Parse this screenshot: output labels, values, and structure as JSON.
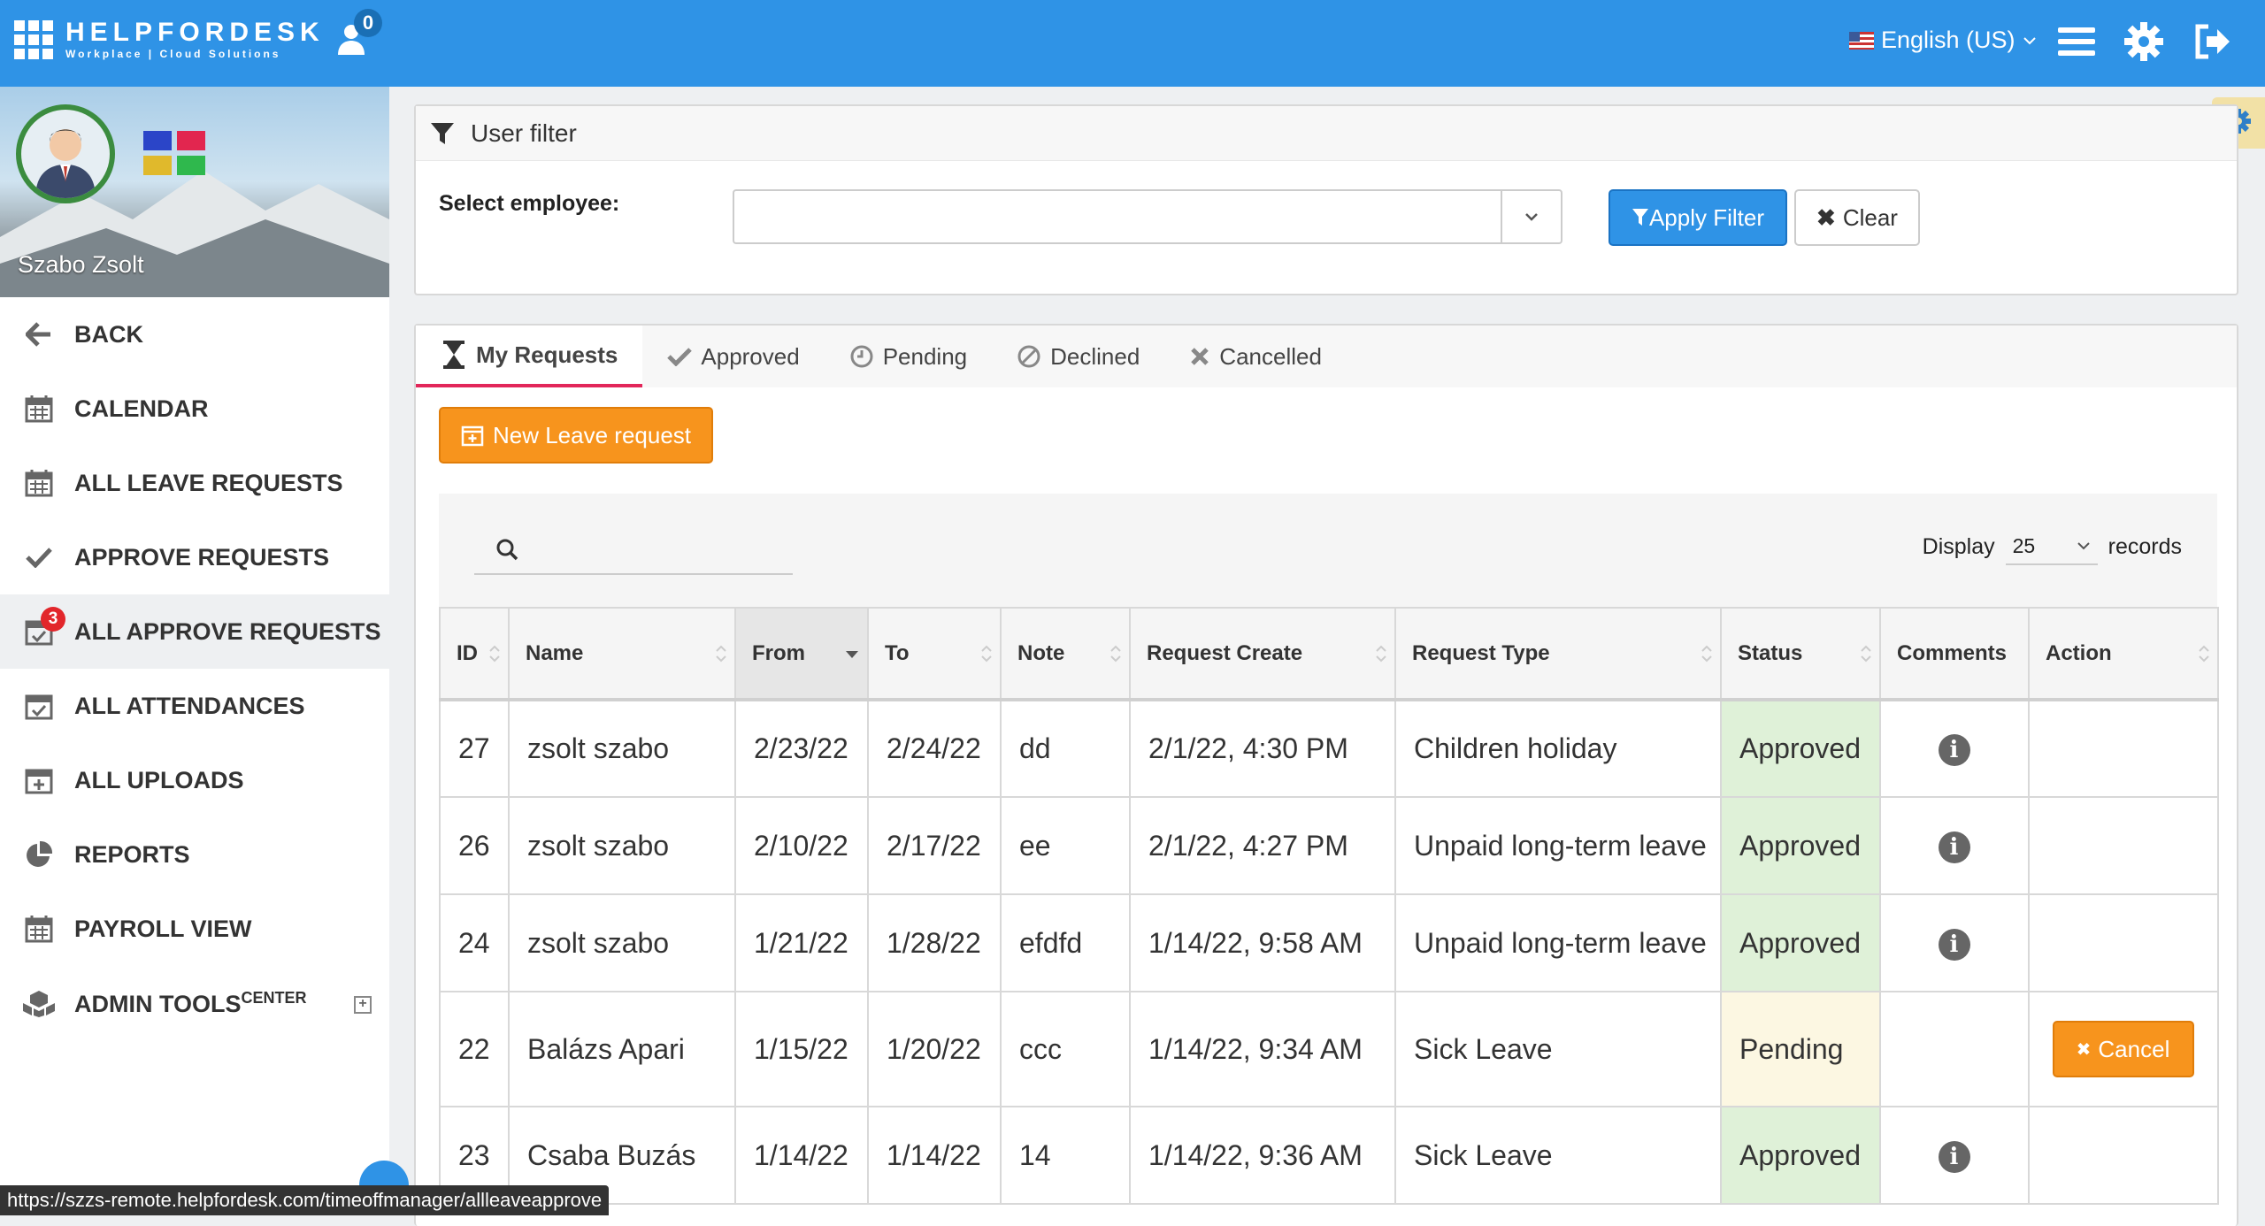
{
  "header": {
    "brand_name": "HELPFORDESK",
    "brand_sub": "Workplace | Cloud Solutions",
    "notifications": "0",
    "language": "English (US)"
  },
  "sidebar": {
    "user_name": "Szabo Zsolt",
    "items": [
      {
        "label": "BACK",
        "icon": "arrow-left-icon"
      },
      {
        "label": "CALENDAR",
        "icon": "calendar-icon"
      },
      {
        "label": "ALL LEAVE REQUESTS",
        "icon": "calendar-icon"
      },
      {
        "label": "APPROVE REQUESTS",
        "icon": "check-icon"
      },
      {
        "label": "ALL APPROVE REQUESTS",
        "icon": "calendar-check-icon",
        "badge": "3"
      },
      {
        "label": "ALL ATTENDANCES",
        "icon": "calendar-check-icon"
      },
      {
        "label": "ALL UPLOADS",
        "icon": "calendar-plus-icon"
      },
      {
        "label": "REPORTS",
        "icon": "pie-chart-icon"
      },
      {
        "label": "PAYROLL VIEW",
        "icon": "calendar-icon"
      },
      {
        "label": "ADMIN TOOLS",
        "sup": "CENTER",
        "icon": "cubes-icon"
      }
    ]
  },
  "filter": {
    "title": "User filter",
    "select_label": "Select employee:",
    "select_value": "",
    "apply_label": "Apply Filter",
    "clear_label": "Clear"
  },
  "tabs": [
    {
      "label": "My Requests",
      "active": true
    },
    {
      "label": "Approved"
    },
    {
      "label": "Pending"
    },
    {
      "label": "Declined"
    },
    {
      "label": "Cancelled"
    }
  ],
  "new_request_label": "New Leave request",
  "table": {
    "display_label": "Display",
    "display_value": "25",
    "records_label": "records",
    "columns": [
      "ID",
      "Name",
      "From",
      "To",
      "Note",
      "Request Create",
      "Request Type",
      "Status",
      "Comments",
      "Action"
    ],
    "rows": [
      {
        "id": "27",
        "name": "zsolt szabo",
        "from": "2/23/22",
        "to": "2/24/22",
        "note": "dd",
        "created": "2/1/22, 4:30 PM",
        "type": "Children holiday",
        "status": "Approved"
      },
      {
        "id": "26",
        "name": "zsolt szabo",
        "from": "2/10/22",
        "to": "2/17/22",
        "note": "ee",
        "created": "2/1/22, 4:27 PM",
        "type": "Unpaid long-term leave",
        "status": "Approved"
      },
      {
        "id": "24",
        "name": "zsolt szabo",
        "from": "1/21/22",
        "to": "1/28/22",
        "note": "efdfd",
        "created": "1/14/22, 9:58 AM",
        "type": "Unpaid long-term leave",
        "status": "Approved"
      },
      {
        "id": "22",
        "name": "Balázs Apari",
        "from": "1/15/22",
        "to": "1/20/22",
        "note": "ccc",
        "created": "1/14/22, 9:34 AM",
        "type": "Sick Leave",
        "status": "Pending",
        "action": "Cancel"
      },
      {
        "id": "23",
        "name": "Csaba Buzás",
        "from": "1/14/22",
        "to": "1/14/22",
        "note": "14",
        "created": "1/14/22, 9:36 AM",
        "type": "Sick Leave",
        "status": "Approved"
      }
    ]
  },
  "status_url": "https://szzs-remote.helpfordesk.com/timeoffmanager/allleaveapprove",
  "colors": {
    "primary": "#2f93e6",
    "orange": "#f7941d",
    "approved": "#dff1d8",
    "pending": "#fcf7e2",
    "tab_accent": "#e2265a"
  }
}
